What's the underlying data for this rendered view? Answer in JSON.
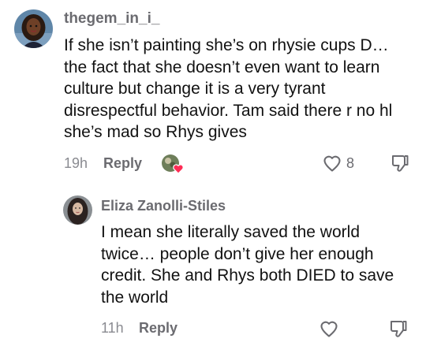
{
  "comments": [
    {
      "username": "thegem_in_i_",
      "text": "If she isn’t painting she’s on rhysie cups D… the fact that she doesn’t even want to learn culture but change it is a very tyrant disrespectful behavior. Tam said there r no hl she’s mad so Rhys gives",
      "time": "19h",
      "reply_label": "Reply",
      "like_count": "8"
    },
    {
      "username": "Eliza Zanolli-Stiles",
      "text": "I mean she literally saved the world twice… people don’t give her enough credit. She and Rhys both DIED to save the world",
      "time": "11h",
      "reply_label": "Reply"
    }
  ],
  "colors": {
    "heart_badge": "#fe2c55",
    "muted_text": "#8a8b91"
  }
}
